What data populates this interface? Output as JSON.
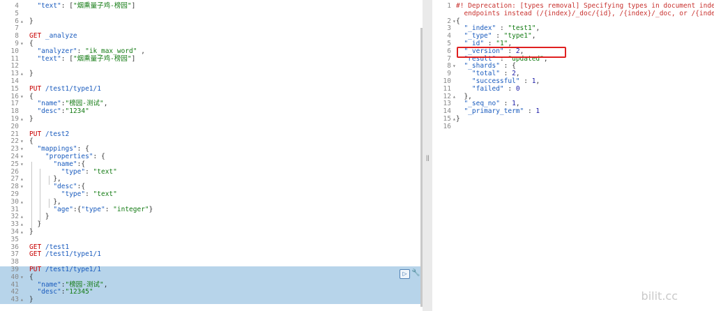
{
  "request_editor": {
    "lines": [
      {
        "n": "4",
        "fold": "",
        "code": [
          {
            "t": "  ",
            "c": "pun"
          },
          {
            "t": "\"text\"",
            "c": "key"
          },
          {
            "t": ": [",
            "c": "pun"
          },
          {
            "t": "\"烟熏量子鸡-榜园\"",
            "c": "str"
          },
          {
            "t": "]",
            "c": "pun"
          }
        ]
      },
      {
        "n": "5",
        "fold": "",
        "code": []
      },
      {
        "n": "6",
        "fold": "▴",
        "code": [
          {
            "t": "}",
            "c": "pun"
          }
        ]
      },
      {
        "n": "7",
        "fold": "",
        "code": []
      },
      {
        "n": "8",
        "fold": "",
        "code": [
          {
            "t": "GET ",
            "c": "method"
          },
          {
            "t": "_analyze",
            "c": "path"
          }
        ]
      },
      {
        "n": "9",
        "fold": "▾",
        "code": [
          {
            "t": "{",
            "c": "pun"
          }
        ]
      },
      {
        "n": "10",
        "fold": "",
        "code": [
          {
            "t": "  ",
            "c": "pun"
          },
          {
            "t": "\"analyzer\"",
            "c": "key"
          },
          {
            "t": ": ",
            "c": "pun"
          },
          {
            "t": "\"ik_max_word\"",
            "c": "str"
          },
          {
            "t": " ,",
            "c": "pun"
          }
        ]
      },
      {
        "n": "11",
        "fold": "",
        "code": [
          {
            "t": "  ",
            "c": "pun"
          },
          {
            "t": "\"text\"",
            "c": "key"
          },
          {
            "t": ": [",
            "c": "pun"
          },
          {
            "t": "\"烟熏量子鸡-榜园\"",
            "c": "str"
          },
          {
            "t": "]",
            "c": "pun"
          }
        ]
      },
      {
        "n": "12",
        "fold": "",
        "code": []
      },
      {
        "n": "13",
        "fold": "▴",
        "code": [
          {
            "t": "}",
            "c": "pun"
          }
        ]
      },
      {
        "n": "14",
        "fold": "",
        "code": []
      },
      {
        "n": "15",
        "fold": "",
        "code": [
          {
            "t": "PUT ",
            "c": "method"
          },
          {
            "t": "/test1/type1/1",
            "c": "path"
          }
        ]
      },
      {
        "n": "16",
        "fold": "▾",
        "code": [
          {
            "t": "{",
            "c": "pun"
          }
        ]
      },
      {
        "n": "17",
        "fold": "",
        "code": [
          {
            "t": "  ",
            "c": "pun"
          },
          {
            "t": "\"name\"",
            "c": "key"
          },
          {
            "t": ":",
            "c": "pun"
          },
          {
            "t": "\"榜园-测试\"",
            "c": "str"
          },
          {
            "t": ",",
            "c": "pun"
          }
        ]
      },
      {
        "n": "18",
        "fold": "",
        "code": [
          {
            "t": "  ",
            "c": "pun"
          },
          {
            "t": "\"desc\"",
            "c": "key"
          },
          {
            "t": ":",
            "c": "pun"
          },
          {
            "t": "\"1234\"",
            "c": "str"
          }
        ]
      },
      {
        "n": "19",
        "fold": "▴",
        "code": [
          {
            "t": "}",
            "c": "pun"
          }
        ]
      },
      {
        "n": "20",
        "fold": "",
        "code": []
      },
      {
        "n": "21",
        "fold": "",
        "code": [
          {
            "t": "PUT ",
            "c": "method"
          },
          {
            "t": "/test2",
            "c": "path"
          }
        ]
      },
      {
        "n": "22",
        "fold": "▾",
        "code": [
          {
            "t": "{",
            "c": "pun"
          }
        ]
      },
      {
        "n": "23",
        "fold": "▾",
        "code": [
          {
            "t": "  ",
            "c": "pun"
          },
          {
            "t": "\"mappings\"",
            "c": "key"
          },
          {
            "t": ": {",
            "c": "pun"
          }
        ]
      },
      {
        "n": "24",
        "fold": "▾",
        "code": [
          {
            "t": "    ",
            "c": "pun"
          },
          {
            "t": "\"properties\"",
            "c": "key"
          },
          {
            "t": ": {",
            "c": "pun"
          }
        ]
      },
      {
        "n": "25",
        "fold": "▾",
        "code": [
          {
            "t": "      ",
            "c": "pun"
          },
          {
            "t": "\"name\"",
            "c": "key"
          },
          {
            "t": ":{",
            "c": "pun"
          }
        ]
      },
      {
        "n": "26",
        "fold": "",
        "code": [
          {
            "t": "        ",
            "c": "pun"
          },
          {
            "t": "\"type\"",
            "c": "key"
          },
          {
            "t": ": ",
            "c": "pun"
          },
          {
            "t": "\"text\"",
            "c": "str"
          }
        ]
      },
      {
        "n": "27",
        "fold": "▴",
        "code": [
          {
            "t": "      },",
            "c": "pun"
          }
        ]
      },
      {
        "n": "28",
        "fold": "▾",
        "code": [
          {
            "t": "      ",
            "c": "pun"
          },
          {
            "t": "\"desc\"",
            "c": "key"
          },
          {
            "t": ":{",
            "c": "pun"
          }
        ]
      },
      {
        "n": "29",
        "fold": "",
        "code": [
          {
            "t": "        ",
            "c": "pun"
          },
          {
            "t": "\"type\"",
            "c": "key"
          },
          {
            "t": ": ",
            "c": "pun"
          },
          {
            "t": "\"text\"",
            "c": "str"
          }
        ]
      },
      {
        "n": "30",
        "fold": "▴",
        "code": [
          {
            "t": "      },",
            "c": "pun"
          }
        ]
      },
      {
        "n": "31",
        "fold": "",
        "code": [
          {
            "t": "      ",
            "c": "pun"
          },
          {
            "t": "\"age\"",
            "c": "key"
          },
          {
            "t": ":{",
            "c": "pun"
          },
          {
            "t": "\"type\"",
            "c": "key"
          },
          {
            "t": ": ",
            "c": "pun"
          },
          {
            "t": "\"integer\"",
            "c": "str"
          },
          {
            "t": "}",
            "c": "pun"
          }
        ]
      },
      {
        "n": "32",
        "fold": "▴",
        "code": [
          {
            "t": "    }",
            "c": "pun"
          }
        ]
      },
      {
        "n": "33",
        "fold": "▴",
        "code": [
          {
            "t": "  }",
            "c": "pun"
          }
        ]
      },
      {
        "n": "34",
        "fold": "▴",
        "code": [
          {
            "t": "}",
            "c": "pun"
          }
        ]
      },
      {
        "n": "35",
        "fold": "",
        "code": []
      },
      {
        "n": "36",
        "fold": "",
        "code": [
          {
            "t": "GET ",
            "c": "method"
          },
          {
            "t": "/test1",
            "c": "path"
          }
        ]
      },
      {
        "n": "37",
        "fold": "",
        "code": [
          {
            "t": "GET ",
            "c": "method"
          },
          {
            "t": "/test1/type1/1",
            "c": "path"
          }
        ]
      },
      {
        "n": "38",
        "fold": "",
        "code": []
      },
      {
        "n": "39",
        "fold": "",
        "sel": true,
        "code": [
          {
            "t": "PUT ",
            "c": "method"
          },
          {
            "t": "/test1/type1/1",
            "c": "path"
          }
        ]
      },
      {
        "n": "40",
        "fold": "▾",
        "sel": true,
        "code": [
          {
            "t": "{",
            "c": "pun"
          }
        ]
      },
      {
        "n": "41",
        "fold": "",
        "sel": true,
        "code": [
          {
            "t": "  ",
            "c": "pun"
          },
          {
            "t": "\"name\"",
            "c": "key"
          },
          {
            "t": ":",
            "c": "pun"
          },
          {
            "t": "\"榜园-测试\"",
            "c": "str"
          },
          {
            "t": ",",
            "c": "pun"
          }
        ]
      },
      {
        "n": "42",
        "fold": "",
        "sel": true,
        "code": [
          {
            "t": "  ",
            "c": "pun"
          },
          {
            "t": "\"desc\"",
            "c": "key"
          },
          {
            "t": ":",
            "c": "pun"
          },
          {
            "t": "\"12345\"",
            "c": "str"
          }
        ]
      },
      {
        "n": "43",
        "fold": "▴",
        "sel": true,
        "code": [
          {
            "t": "}",
            "c": "pun"
          }
        ]
      }
    ],
    "actions": {
      "run_icon": "play-icon",
      "run_label": "▷",
      "wrench_icon": "wrench-icon",
      "wrench_label": "🔧"
    }
  },
  "divider": {
    "grip_label": "||"
  },
  "response_viewer": {
    "lines": [
      {
        "n": "1",
        "fold": "",
        "code": [
          {
            "t": "#! Deprecation: [types removal] Specifying types in document index requests is deprecated, use the typeless",
            "c": "warn"
          }
        ]
      },
      {
        "n": "",
        "fold": "",
        "code": [
          {
            "t": "  endpoints instead (/{index}/_doc/{id}, /{index}/_doc, or /{index}/_create/{id}).",
            "c": "warn"
          }
        ]
      },
      {
        "n": "2",
        "fold": "▾",
        "code": [
          {
            "t": "{",
            "c": "pun"
          }
        ]
      },
      {
        "n": "3",
        "fold": "",
        "code": [
          {
            "t": "  ",
            "c": "pun"
          },
          {
            "t": "\"_index\"",
            "c": "key"
          },
          {
            "t": " : ",
            "c": "pun"
          },
          {
            "t": "\"test1\"",
            "c": "str"
          },
          {
            "t": ",",
            "c": "pun"
          }
        ]
      },
      {
        "n": "4",
        "fold": "",
        "code": [
          {
            "t": "  ",
            "c": "pun"
          },
          {
            "t": "\"_type\"",
            "c": "key"
          },
          {
            "t": " : ",
            "c": "pun"
          },
          {
            "t": "\"type1\"",
            "c": "str"
          },
          {
            "t": ",",
            "c": "pun"
          }
        ]
      },
      {
        "n": "5",
        "fold": "",
        "code": [
          {
            "t": "  ",
            "c": "pun"
          },
          {
            "t": "\"_id\"",
            "c": "key"
          },
          {
            "t": " : ",
            "c": "pun"
          },
          {
            "t": "\"1\"",
            "c": "str"
          },
          {
            "t": ",",
            "c": "pun"
          }
        ]
      },
      {
        "n": "6",
        "fold": "",
        "code": [
          {
            "t": "  ",
            "c": "pun"
          },
          {
            "t": "\"_version\"",
            "c": "key"
          },
          {
            "t": " : ",
            "c": "pun"
          },
          {
            "t": "2",
            "c": "num"
          },
          {
            "t": ",",
            "c": "pun"
          }
        ]
      },
      {
        "n": "7",
        "fold": "",
        "code": [
          {
            "t": "  ",
            "c": "pun"
          },
          {
            "t": "\"result\"",
            "c": "key"
          },
          {
            "t": " : ",
            "c": "pun"
          },
          {
            "t": "\"updated\"",
            "c": "str"
          },
          {
            "t": ",",
            "c": "pun"
          }
        ]
      },
      {
        "n": "8",
        "fold": "▾",
        "code": [
          {
            "t": "  ",
            "c": "pun"
          },
          {
            "t": "\"_shards\"",
            "c": "key"
          },
          {
            "t": " : {",
            "c": "pun"
          }
        ]
      },
      {
        "n": "9",
        "fold": "",
        "code": [
          {
            "t": "    ",
            "c": "pun"
          },
          {
            "t": "\"total\"",
            "c": "key"
          },
          {
            "t": " : ",
            "c": "pun"
          },
          {
            "t": "2",
            "c": "num"
          },
          {
            "t": ",",
            "c": "pun"
          }
        ]
      },
      {
        "n": "10",
        "fold": "",
        "code": [
          {
            "t": "    ",
            "c": "pun"
          },
          {
            "t": "\"successful\"",
            "c": "key"
          },
          {
            "t": " : ",
            "c": "pun"
          },
          {
            "t": "1",
            "c": "num"
          },
          {
            "t": ",",
            "c": "pun"
          }
        ]
      },
      {
        "n": "11",
        "fold": "",
        "code": [
          {
            "t": "    ",
            "c": "pun"
          },
          {
            "t": "\"failed\"",
            "c": "key"
          },
          {
            "t": " : ",
            "c": "pun"
          },
          {
            "t": "0",
            "c": "num"
          }
        ]
      },
      {
        "n": "12",
        "fold": "▴",
        "code": [
          {
            "t": "  },",
            "c": "pun"
          }
        ]
      },
      {
        "n": "13",
        "fold": "",
        "code": [
          {
            "t": "  ",
            "c": "pun"
          },
          {
            "t": "\"_seq_no\"",
            "c": "key"
          },
          {
            "t": " : ",
            "c": "pun"
          },
          {
            "t": "1",
            "c": "num"
          },
          {
            "t": ",",
            "c": "pun"
          }
        ]
      },
      {
        "n": "14",
        "fold": "",
        "code": [
          {
            "t": "  ",
            "c": "pun"
          },
          {
            "t": "\"_primary_term\"",
            "c": "key"
          },
          {
            "t": " : ",
            "c": "pun"
          },
          {
            "t": "1",
            "c": "num"
          }
        ]
      },
      {
        "n": "15",
        "fold": "▴",
        "code": [
          {
            "t": "}",
            "c": "pun"
          }
        ]
      },
      {
        "n": "16",
        "fold": "",
        "code": []
      }
    ]
  },
  "watermark": "bilit.cc",
  "colors": {
    "selection": "#b7d4ea",
    "highlight_box": "#e02020",
    "method": "#c80000",
    "path_key": "#185abd",
    "string": "#127a12"
  }
}
